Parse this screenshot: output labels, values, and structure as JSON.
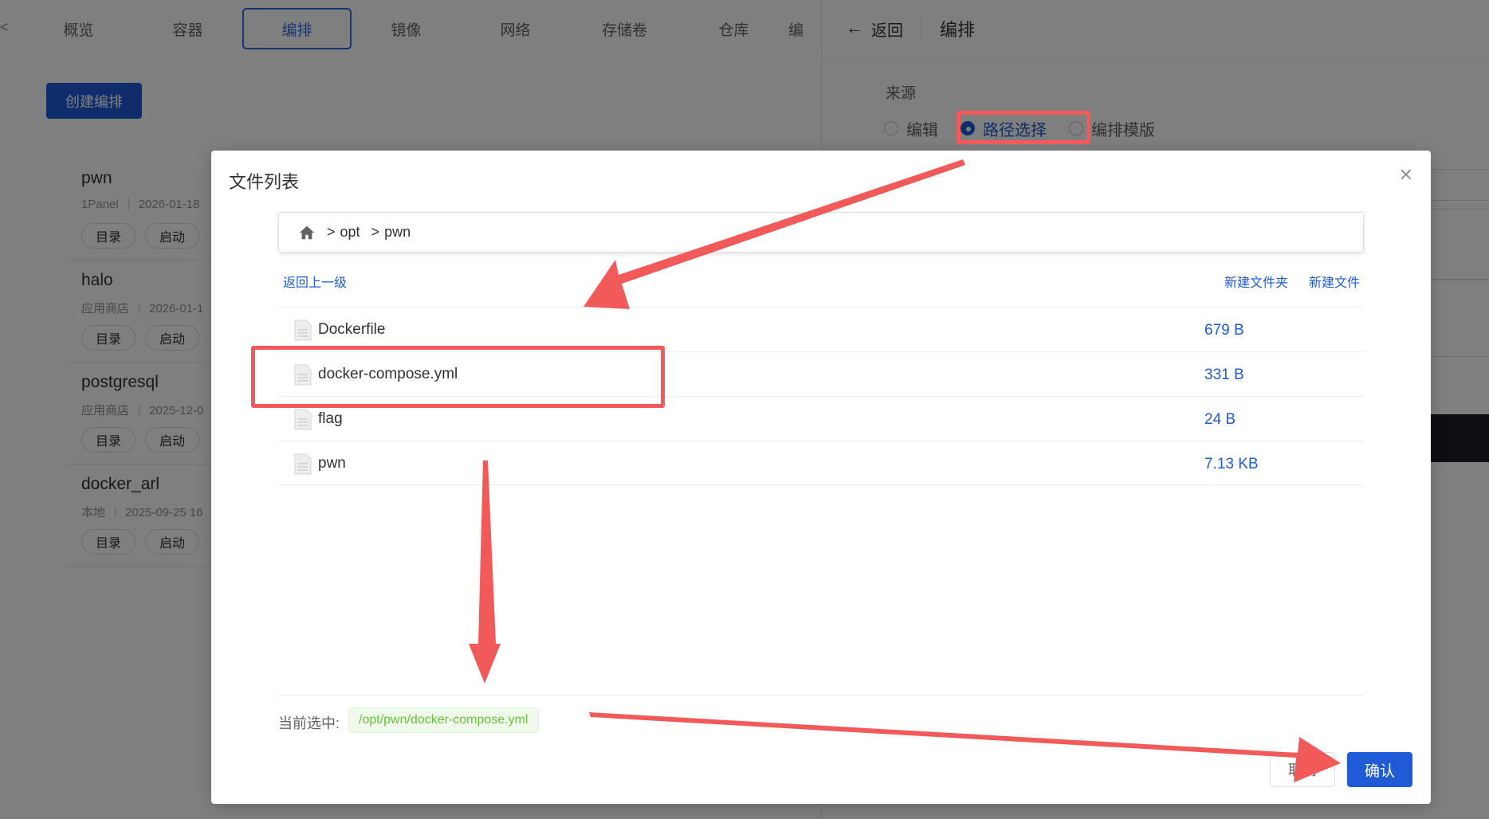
{
  "tabs": [
    "概览",
    "容器",
    "编排",
    "镜像",
    "网络",
    "存储卷",
    "仓库"
  ],
  "tab_active_index": 2,
  "tab_partial": "编",
  "left_edge_glyph": "<",
  "create_button": "创建编排",
  "apps": [
    {
      "name": "pwn",
      "source": "1Panel",
      "date": "2026-01-18",
      "btn_dir": "目录",
      "btn_start": "启动"
    },
    {
      "name": "halo",
      "source": "应用商店",
      "date": "2026-01-1",
      "btn_dir": "目录",
      "btn_start": "启动"
    },
    {
      "name": "postgresql",
      "source": "应用商店",
      "date": "2025-12-0",
      "btn_dir": "目录",
      "btn_start": "启动"
    },
    {
      "name": "docker_arl",
      "source": "本地",
      "date": "2025-09-25 16",
      "btn_dir": "目录",
      "btn_start": "启动"
    }
  ],
  "drawer": {
    "back": "返回",
    "title": "编排",
    "source_label": "来源",
    "radio_edit": "编辑",
    "radio_path": "路径选择",
    "radio_template": "编排模版",
    "selected_radio": "路径选择"
  },
  "dialog": {
    "title": "文件列表",
    "breadcrumb": [
      "opt",
      "pwn"
    ],
    "back_up": "返回上一级",
    "new_folder": "新建文件夹",
    "new_file": "新建文件",
    "files": [
      {
        "name": "Dockerfile",
        "size": "679 B"
      },
      {
        "name": "docker-compose.yml",
        "size": "331 B"
      },
      {
        "name": "flag",
        "size": "24 B"
      },
      {
        "name": "pwn",
        "size": "7.13 KB"
      }
    ],
    "current_label": "当前选中:",
    "current_value": "/opt/pwn/docker-compose.yml",
    "cancel": "取消",
    "confirm": "确认"
  },
  "colors": {
    "primary": "#1f5bd6",
    "annotation": "#f25a5a",
    "tag_green": "#67c23a"
  }
}
